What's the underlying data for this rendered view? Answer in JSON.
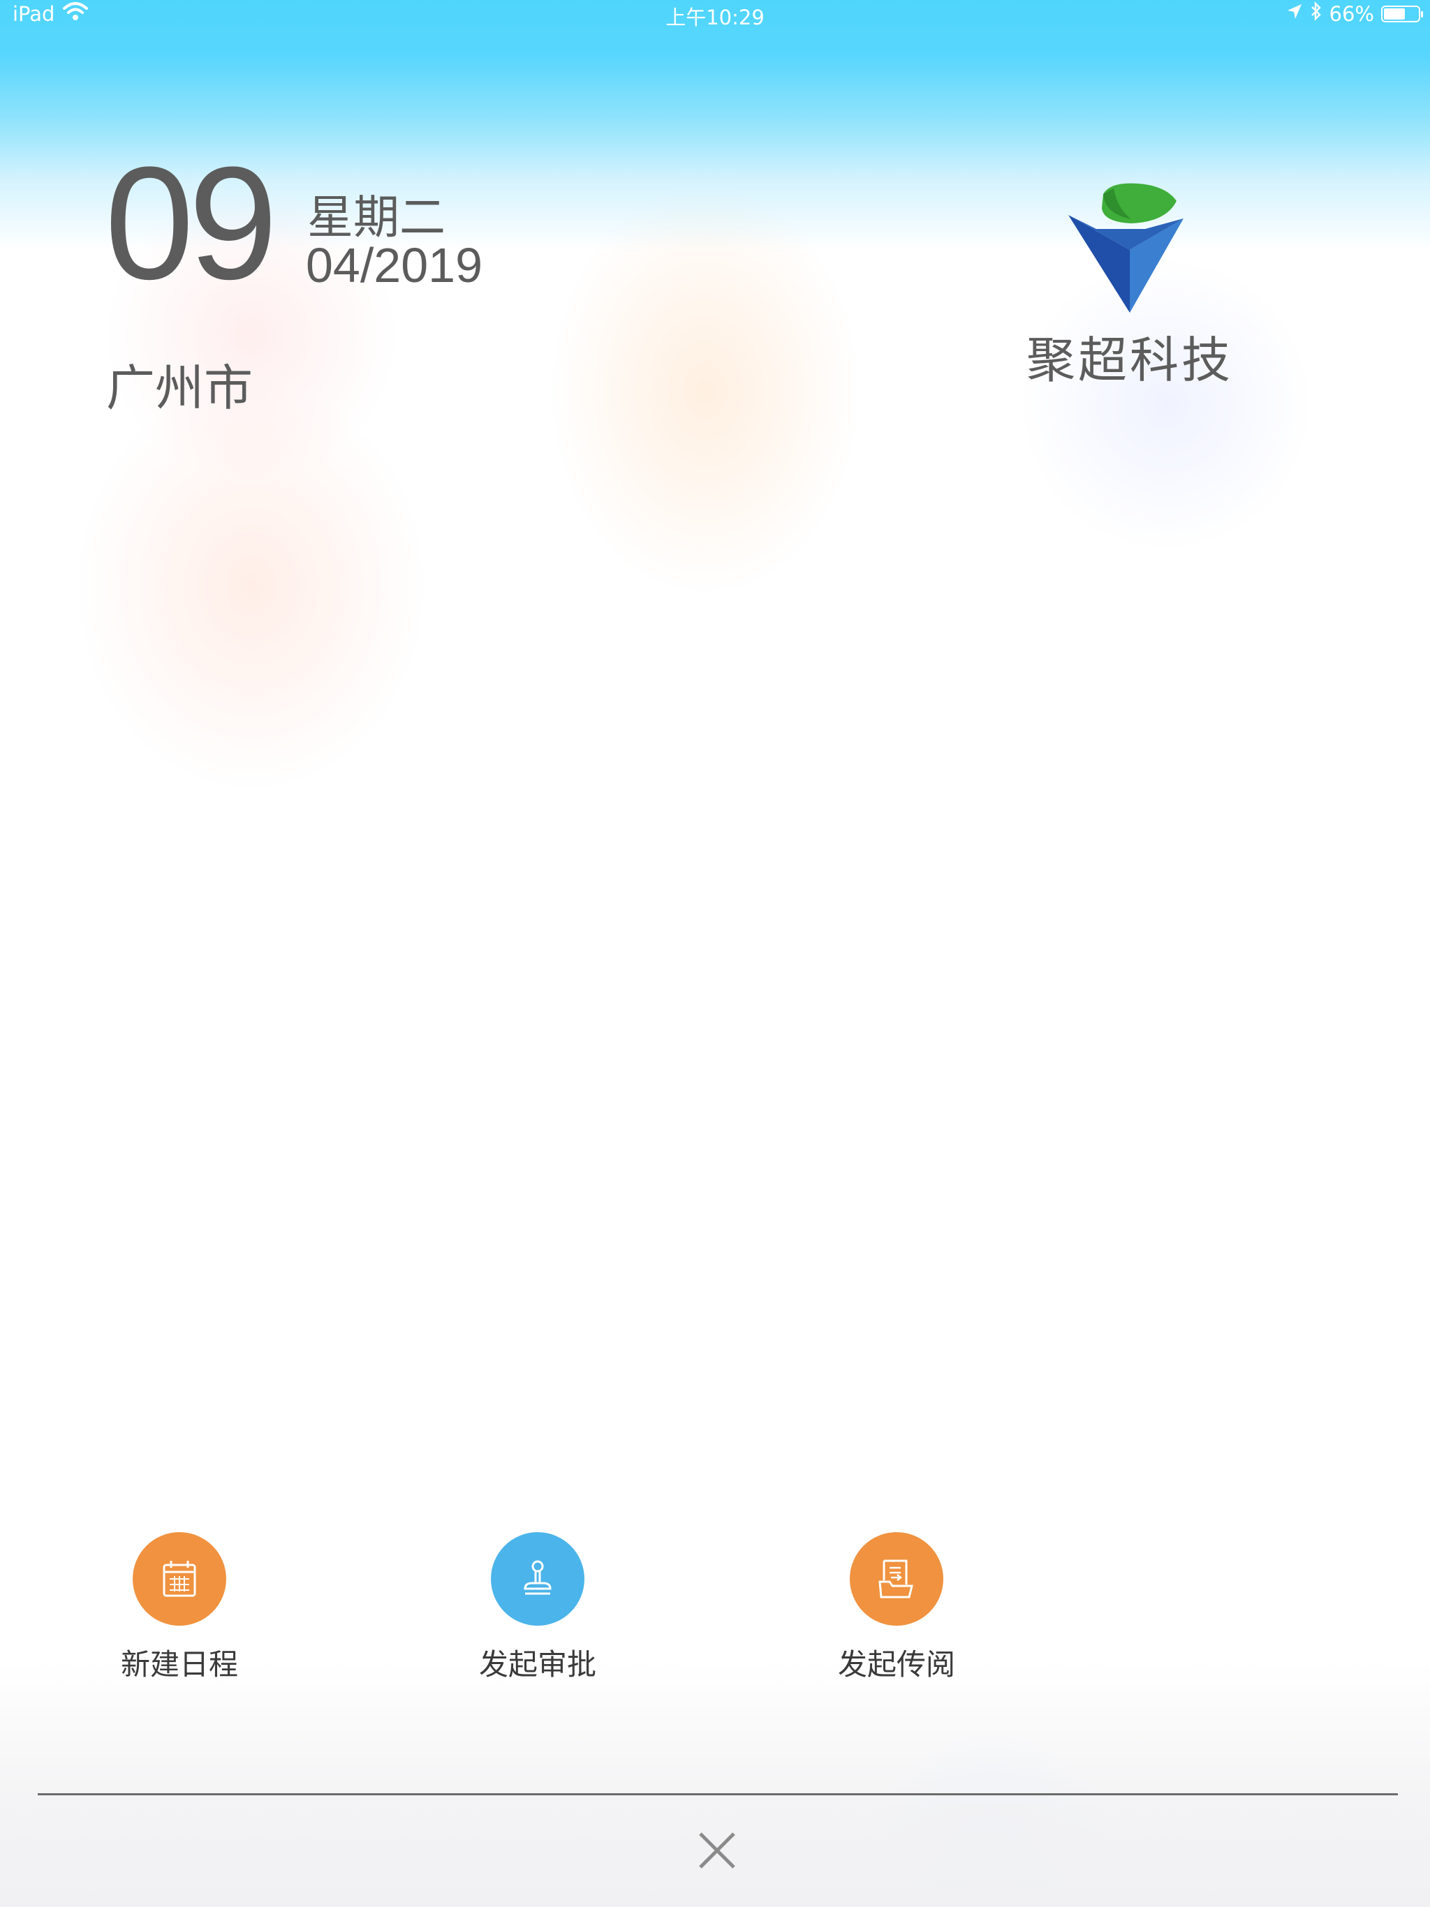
{
  "status_bar": {
    "device": "iPad",
    "time": "上午10:29",
    "battery": "66%",
    "battery_level": 0.66
  },
  "date": {
    "day": "09",
    "weekday": "星期二",
    "month_year": "04/2019"
  },
  "location": {
    "city": "广州市"
  },
  "brand": {
    "name": "聚超科技"
  },
  "actions": [
    {
      "label": "新建日程",
      "icon": "calendar-icon",
      "color": "#f0923f"
    },
    {
      "label": "发起审批",
      "icon": "stamp-icon",
      "color": "#4bb4ea"
    },
    {
      "label": "发起传阅",
      "icon": "document-forward-icon",
      "color": "#f0923f"
    }
  ],
  "close": {
    "icon": "close-icon"
  },
  "colors": {
    "header_blue": "#4fd5fd",
    "text_gray": "#5c5c5c",
    "orange": "#f0923f",
    "blue": "#4bb4ea"
  }
}
